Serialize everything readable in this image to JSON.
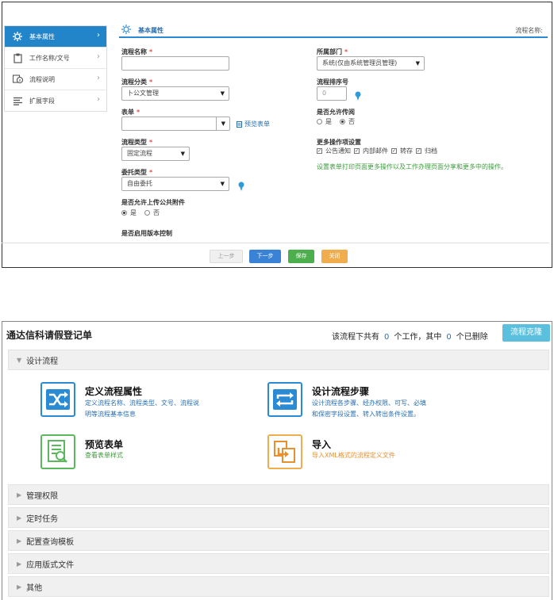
{
  "sidebar": {
    "items": [
      {
        "label": "基本属性",
        "icon": "gear-icon",
        "active": true
      },
      {
        "label": "工作名称/文号",
        "icon": "clipboard-icon",
        "active": false
      },
      {
        "label": "流程说明",
        "icon": "info-icon",
        "active": false
      },
      {
        "label": "扩展字段",
        "icon": "list-icon",
        "active": false
      }
    ]
  },
  "header": {
    "title": "基本属性",
    "right_label": "流程名称:"
  },
  "form": {
    "name_label": "流程名称",
    "name_value": "",
    "category_label": "流程分类",
    "category_value": "卜公文管理",
    "form_label": "表单",
    "form_value": "",
    "preview_link": "预览表单",
    "flow_type_label": "流程类型",
    "flow_type_value": "固定流程",
    "delegate_label": "委托类型",
    "delegate_value": "自由委托",
    "upload_label": "是否允许上传公共附件",
    "upload_yes": "是",
    "upload_no": "否",
    "version_label": "是否启用版本控制",
    "dept_label": "所属部门",
    "dept_value": "系统(仅由系统管理员管理)",
    "order_label": "流程排序号",
    "order_value": "0",
    "comment_label": "是否允许传阅",
    "comment_yes": "是",
    "comment_no": "否",
    "more_ops_label": "更多操作项设置",
    "more_ops": [
      "公告通知",
      "内部邮件",
      "转存",
      "归档"
    ],
    "more_ops_hint": "设置表单打印页面更多操作以及工作办理页面分享和更多中的操作。",
    "required_mark": "*"
  },
  "buttons": {
    "prev": "上一步",
    "next": "下一步",
    "save": "保存",
    "close": "关闭"
  },
  "colors": {
    "primary": "#2385c9",
    "next": "#3a82d6",
    "save": "#4cae4c",
    "close": "#f0ad4e",
    "clone": "#5bc0de"
  },
  "bottom": {
    "title": "通达信科请假登记单",
    "info_prefix": "该流程下共有",
    "work_count": "0",
    "info_middle": "个工作，其中",
    "deleted_count": "0",
    "info_suffix": "个已删除",
    "clone_button": "流程克隆",
    "sections": {
      "design": "设计流程",
      "permissions": "管理权限",
      "timer": "定时任务",
      "query_template": "配置查询模板",
      "app_files": "应用版式文件",
      "other": "其他"
    },
    "cards": {
      "define": {
        "title": "定义流程属性",
        "desc1": "定义流程名称、流程类型、文号、流程说",
        "desc2": "明等流程基本信息"
      },
      "steps": {
        "title": "设计流程步骤",
        "desc1": "设计流程各步骤、经办权限、可写、必填",
        "desc2": "和保密字段设置、转入转出条件设置。"
      },
      "preview": {
        "title": "预览表单",
        "desc1": "查看表单样式"
      },
      "import": {
        "title": "导入",
        "desc1": "导入XML格式的流程定义文件"
      }
    }
  }
}
